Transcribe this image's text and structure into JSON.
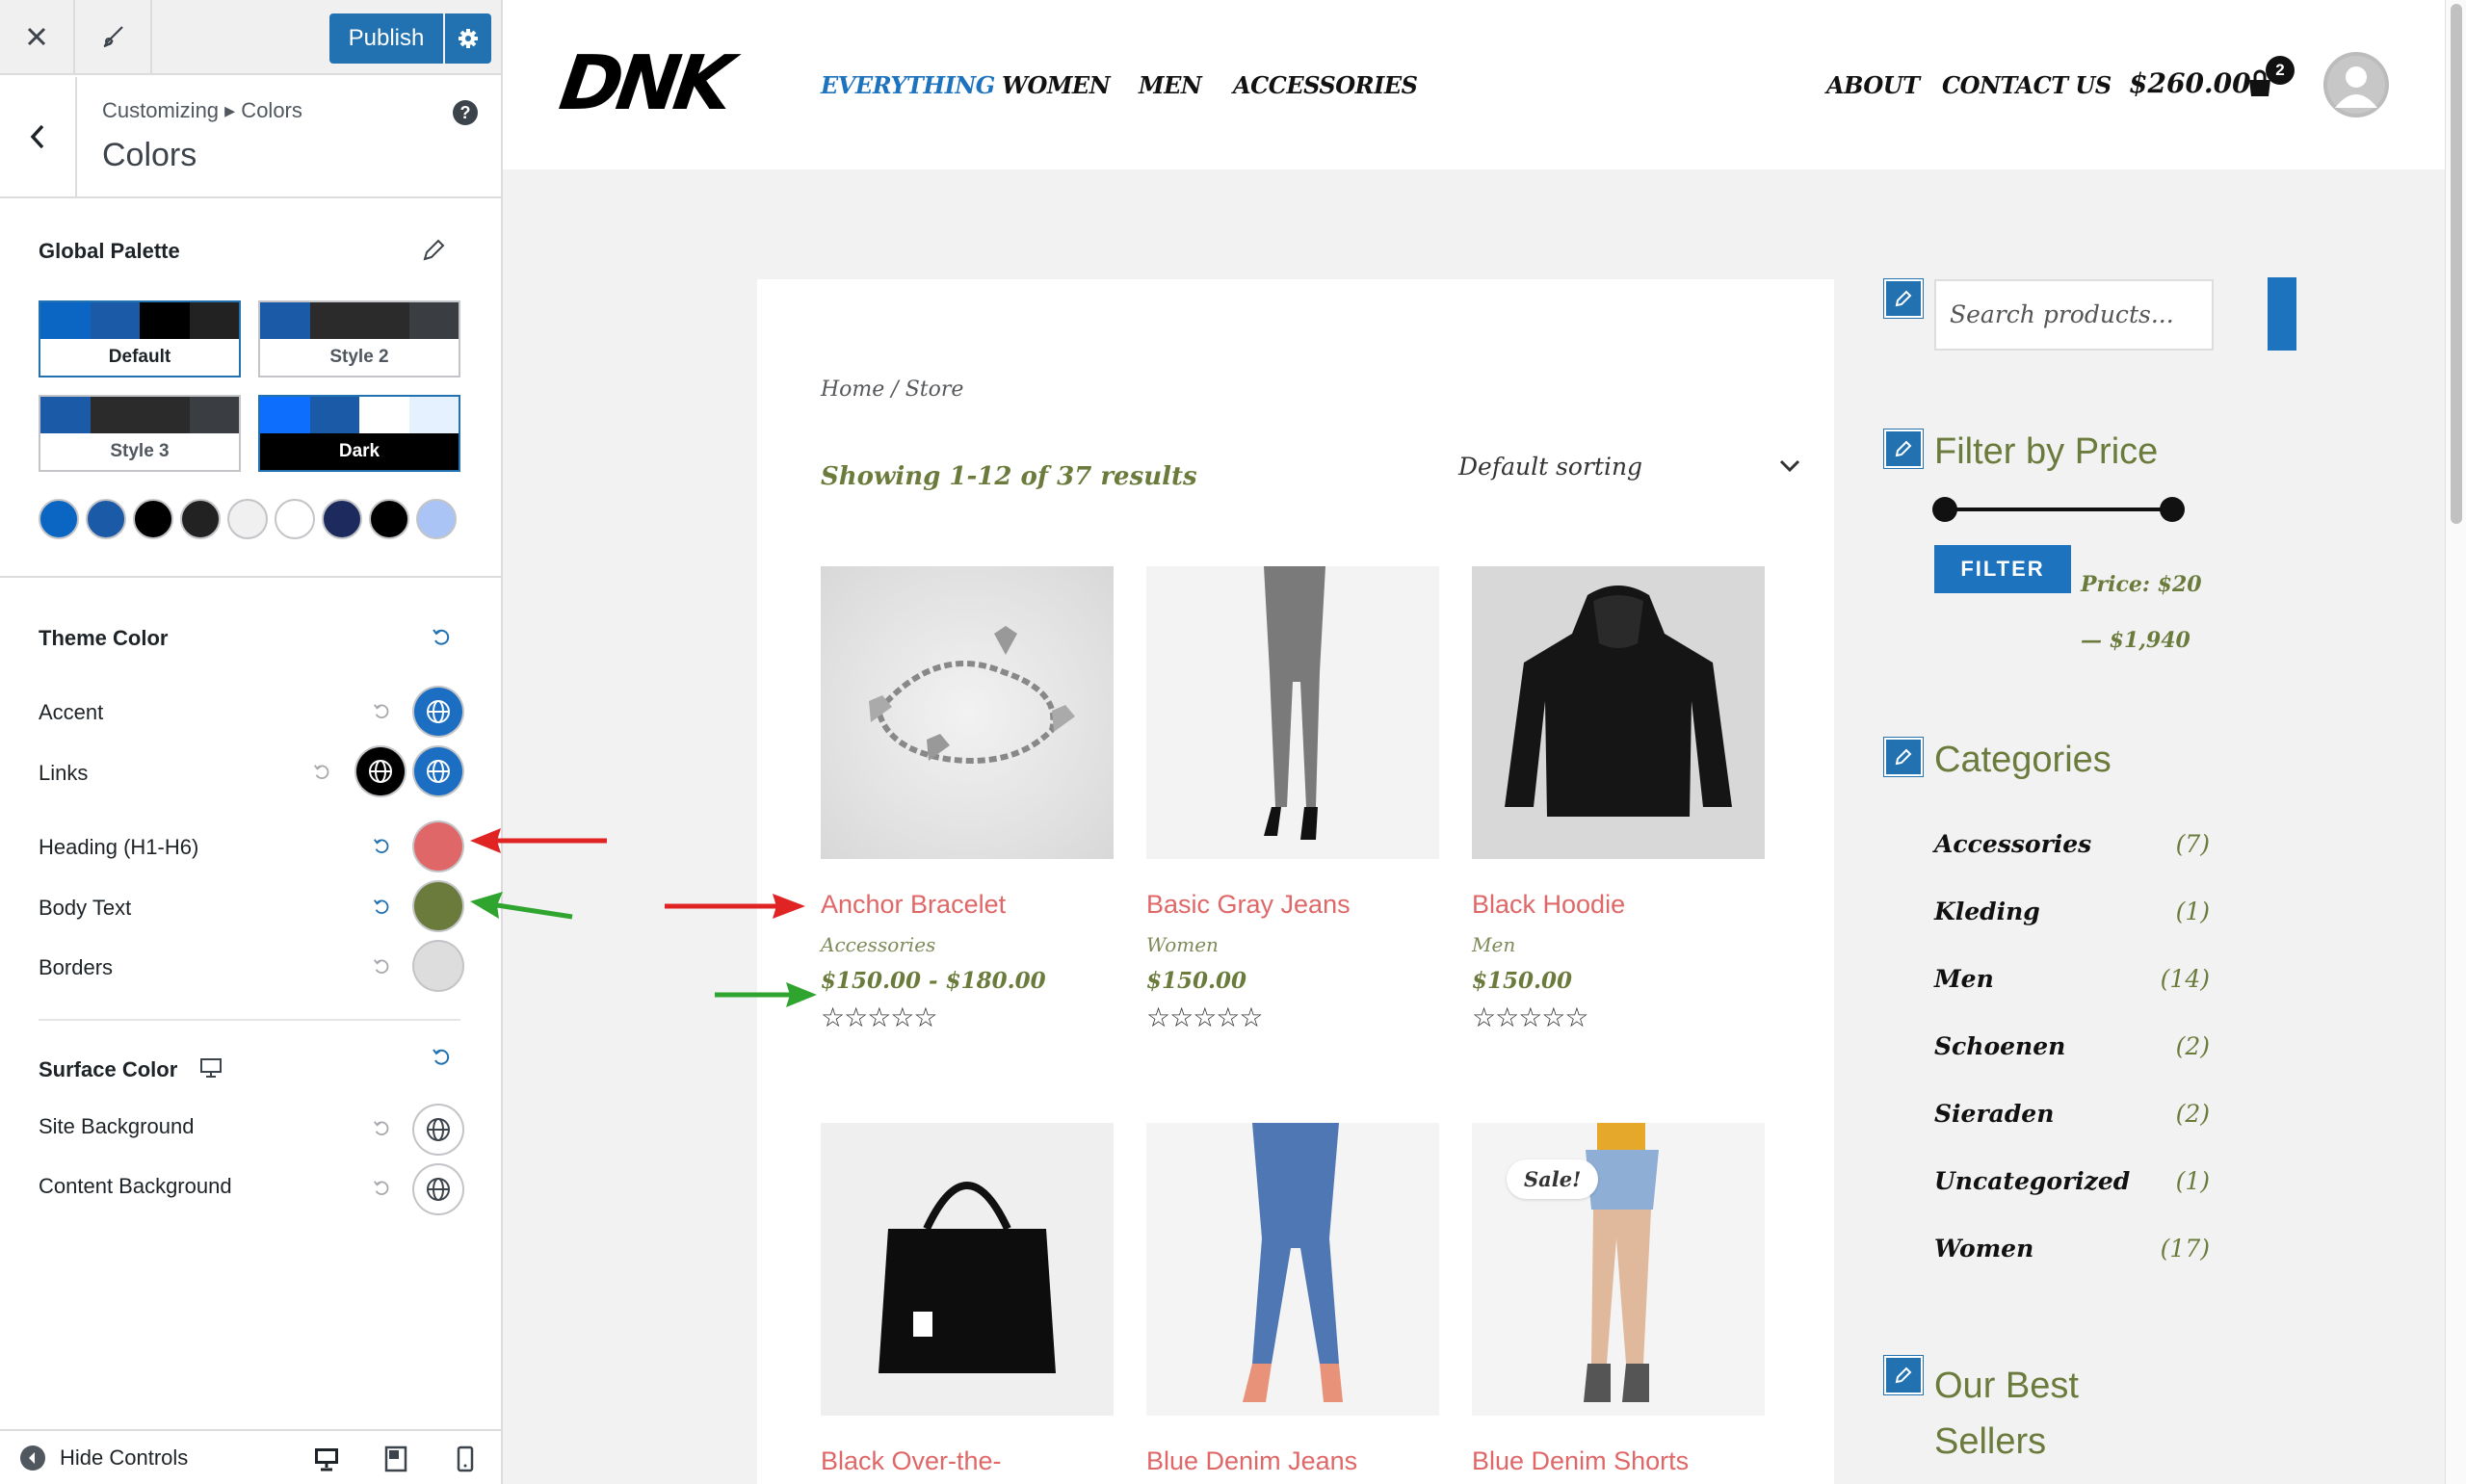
{
  "topbar": {
    "publish_label": "Publish"
  },
  "section": {
    "breadcrumb": "Customizing ▸ Colors",
    "title": "Colors",
    "help": "?"
  },
  "global_palette": {
    "title": "Global Palette",
    "palettes": [
      {
        "name": "Default",
        "colors": [
          "#0a66c2",
          "#1b5aa6",
          "#000000",
          "#222222"
        ]
      },
      {
        "name": "Style 2",
        "colors": [
          "#1b5aa6",
          "#2b2b2b",
          "#2b2b2b",
          "#3a3d42"
        ]
      },
      {
        "name": "Style 3",
        "colors": [
          "#1b5aa6",
          "#2b2b2b",
          "#2b2b2b",
          "#3a3d42"
        ]
      },
      {
        "name": "Dark",
        "colors": [
          "#0d6efd",
          "#1b5aa6",
          "#ffffff",
          "#e6f1ff"
        ]
      }
    ],
    "swatches": [
      "#0a66c2",
      "#1b5aa6",
      "#000000",
      "#222222",
      "#f0f0f1",
      "#ffffff",
      "#1c2a5e",
      "#000000",
      "#a9c4f5"
    ]
  },
  "theme_color": {
    "title": "Theme Color",
    "rows": [
      {
        "label": "Accent"
      },
      {
        "label": "Links"
      },
      {
        "label": "Heading (H1-H6)",
        "color": "#e06767"
      },
      {
        "label": "Body Text",
        "color": "#6a7b3c"
      },
      {
        "label": "Borders",
        "color": "#dddddd"
      }
    ]
  },
  "surface_color": {
    "title": "Surface Color",
    "rows": [
      {
        "label": "Site Background"
      },
      {
        "label": "Content Background"
      }
    ]
  },
  "footer": {
    "hide_controls": "Hide Controls"
  },
  "site": {
    "logo": "DNK",
    "nav": [
      "EVERYTHING",
      "WOMEN",
      "MEN",
      "ACCESSORIES"
    ],
    "nav_right": [
      "ABOUT",
      "CONTACT US"
    ],
    "cart_total": "$260.00",
    "cart_count": "2",
    "breadcrumb": "Home / Store",
    "results": "Showing 1-12 of 37 results",
    "sorting": "Default sorting",
    "products": [
      {
        "title": "Anchor Bracelet",
        "category": "Accessories",
        "price": "$150.00 - $180.00",
        "stars": "☆☆☆☆☆"
      },
      {
        "title": "Basic Gray Jeans",
        "category": "Women",
        "price": "$150.00",
        "stars": "☆☆☆☆☆"
      },
      {
        "title": "Black Hoodie",
        "category": "Men",
        "price": "$150.00",
        "stars": "☆☆☆☆☆"
      },
      {
        "title": "Black Over-the-",
        "sale": ""
      },
      {
        "title": "Blue Denim Jeans",
        "sale": ""
      },
      {
        "title": "Blue Denim Shorts",
        "sale": "Sale!"
      }
    ],
    "sidebar": {
      "search_placeholder": "Search products...",
      "filter_title": "Filter by Price",
      "filter_button": "FILTER",
      "price_range": "Price: $20 — $1,940",
      "categories_title": "Categories",
      "categories": [
        {
          "name": "Accessories",
          "count": "(7)"
        },
        {
          "name": "Kleding",
          "count": "(1)"
        },
        {
          "name": "Men",
          "count": "(14)"
        },
        {
          "name": "Schoenen",
          "count": "(2)"
        },
        {
          "name": "Sieraden",
          "count": "(2)"
        },
        {
          "name": "Uncategorized",
          "count": "(1)"
        },
        {
          "name": "Women",
          "count": "(17)"
        }
      ],
      "best_sellers_title": "Our Best Sellers"
    }
  }
}
